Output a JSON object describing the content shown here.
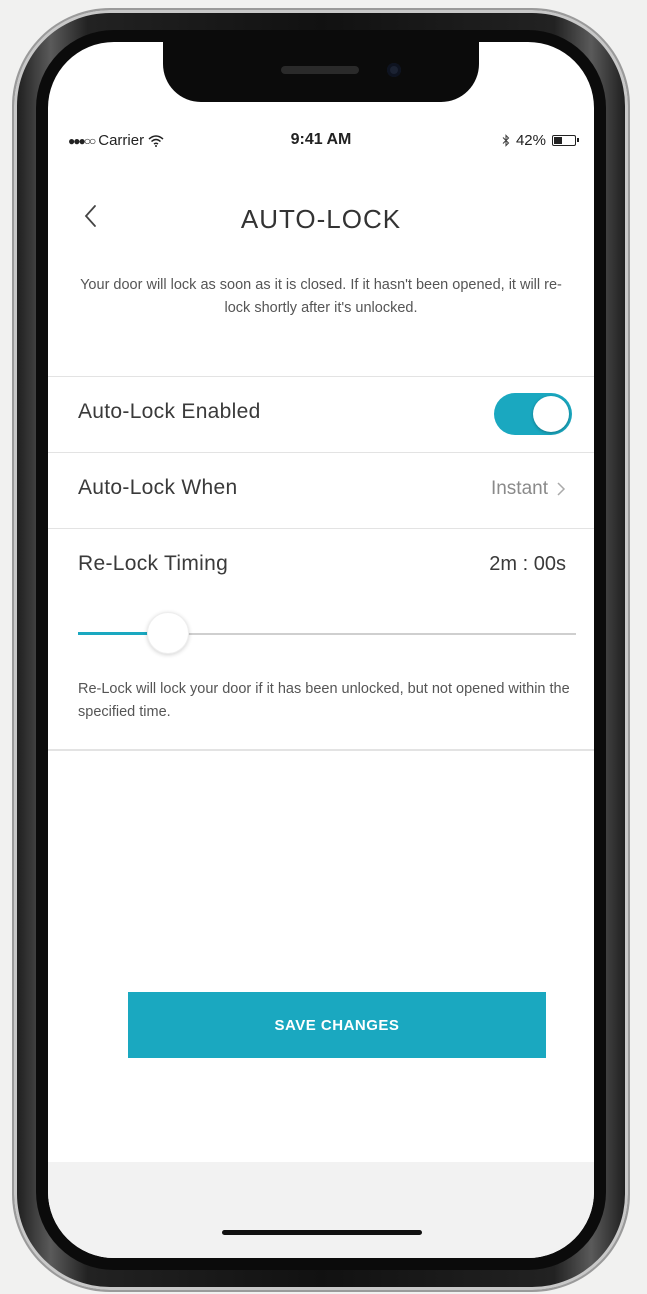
{
  "status_bar": {
    "signal": "●●●○○",
    "carrier": "Carrier",
    "wifi_icon": "wifi-icon",
    "time": "9:41 AM",
    "bluetooth_icon": "bluetooth-icon",
    "battery_percent": "42%",
    "battery_level": 0.42
  },
  "nav": {
    "title": "AUTO-LOCK",
    "back_icon": "chevron-left-icon"
  },
  "description": "Your door will lock as soon as it is closed. If it hasn't been opened, it will re-lock shortly after it's unlocked.",
  "settings": {
    "auto_lock_enabled": {
      "label": "Auto-Lock Enabled",
      "enabled": true
    },
    "auto_lock_when": {
      "label": "Auto-Lock When",
      "value": "Instant"
    },
    "relock_timing": {
      "label": "Re-Lock Timing",
      "value": "2m : 00s",
      "slider_fraction": 0.18
    }
  },
  "relock_note": "Re-Lock will lock your door if it has been unlocked, but not opened within the specified time.",
  "save_button": {
    "label": "SAVE CHANGES"
  },
  "colors": {
    "accent": "#1aa8c0"
  }
}
